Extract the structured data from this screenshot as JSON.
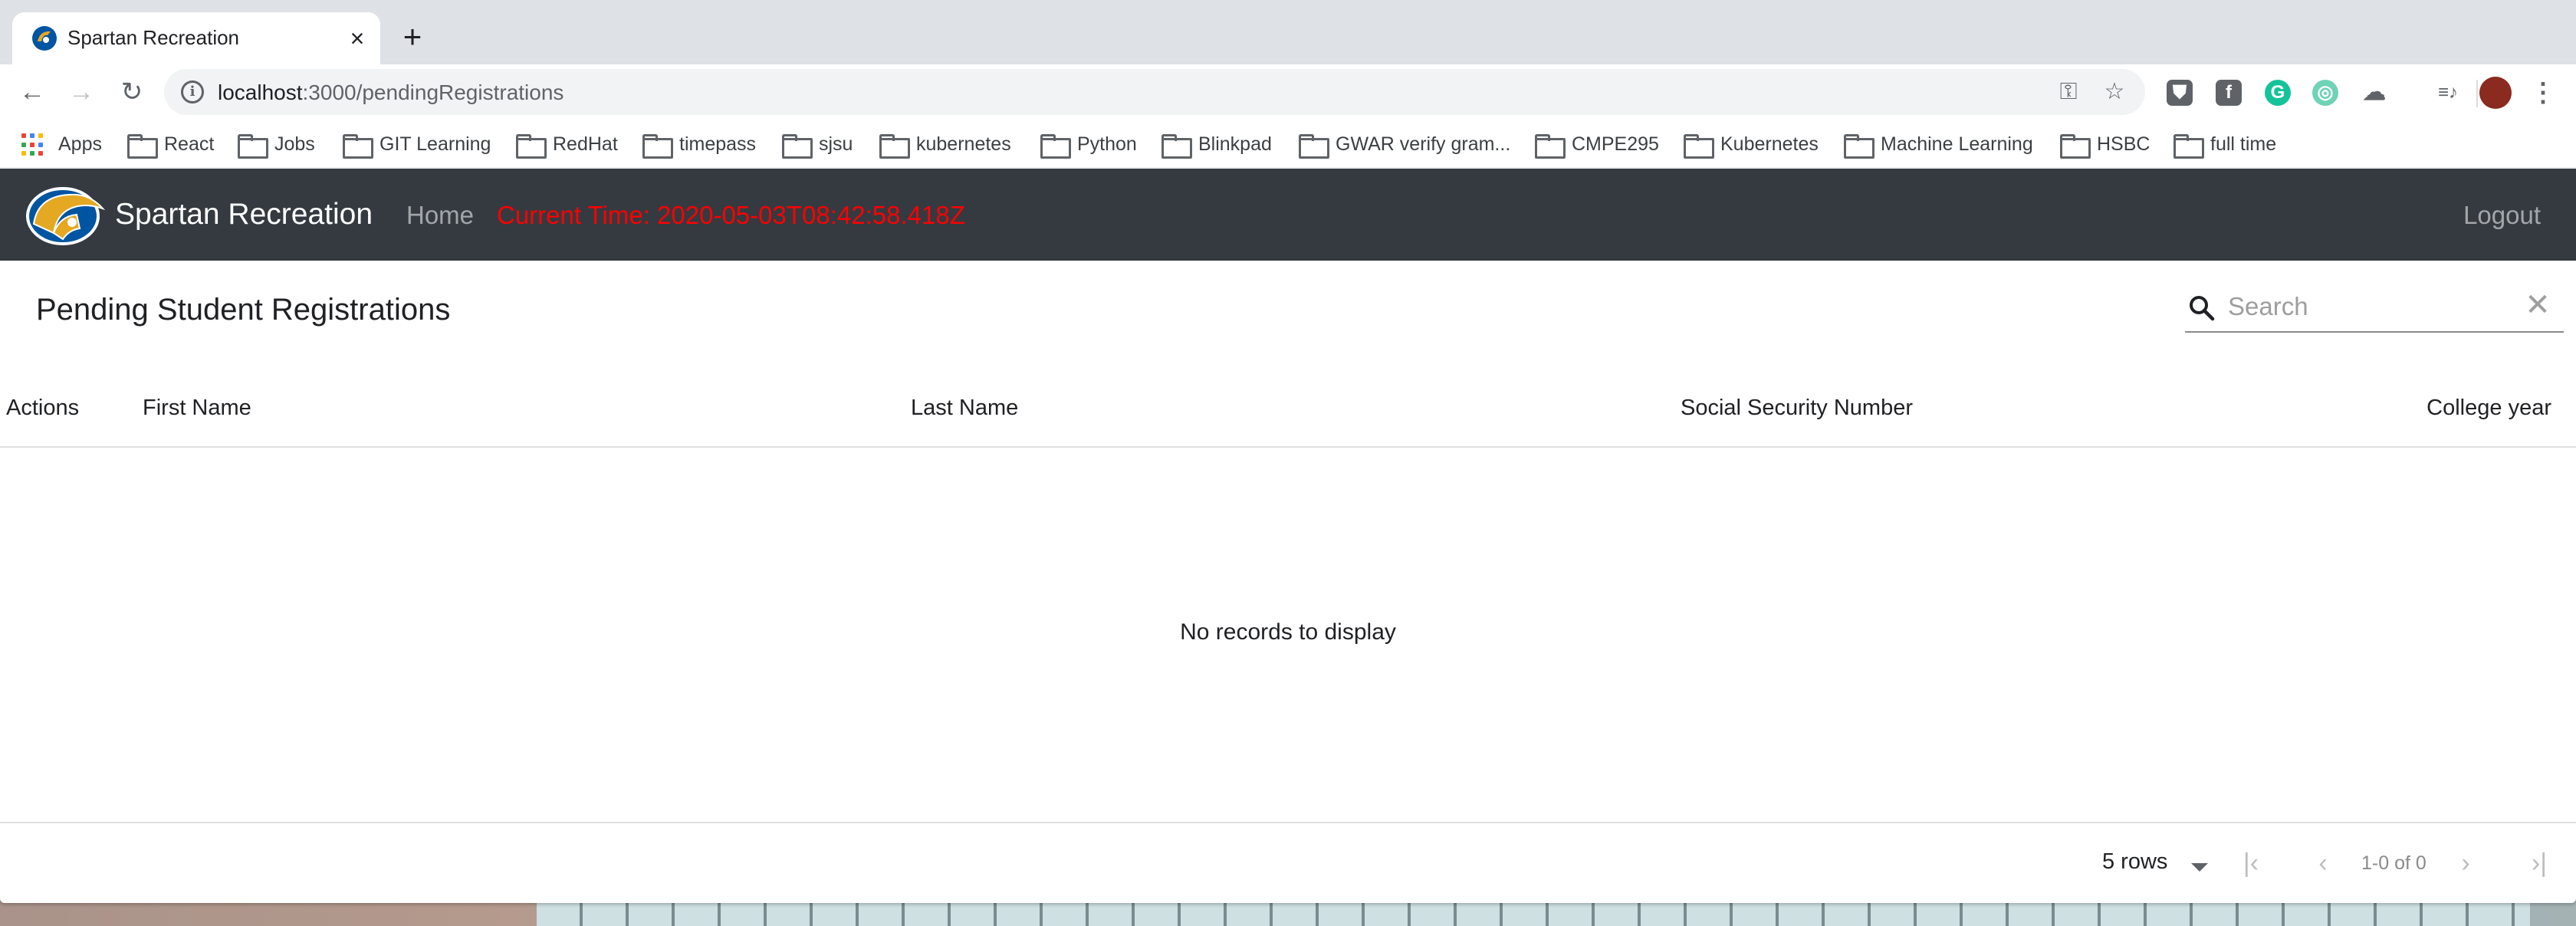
{
  "browser": {
    "tab": {
      "title": "Spartan Recreation",
      "close_glyph": "×"
    },
    "new_tab_glyph": "+",
    "address": {
      "host": "localhost",
      "path": ":3000/pendingRegistrations"
    },
    "nav": {
      "back": "←",
      "forward": "→",
      "reload": "↻"
    },
    "omnibox_icons": {
      "key": "⚿",
      "star": "☆"
    },
    "extensions": [
      {
        "name": "shield-extension-icon",
        "glyph": "⛊",
        "color": "#5f6368"
      },
      {
        "name": "facebook-extension-icon",
        "glyph": "f",
        "color": "#5f6368"
      },
      {
        "name": "grammarly-extension-icon",
        "glyph": "G",
        "color": "#15c39a"
      },
      {
        "name": "color-picker-extension-icon",
        "glyph": "◎",
        "color": "#6fd3b5"
      },
      {
        "name": "cloud-extension-icon",
        "glyph": "☁",
        "color": "#5f6368"
      }
    ],
    "menu_glyph": "⋮",
    "media_glyph": "≡♪"
  },
  "bookmarks": {
    "apps_label": "Apps",
    "items": [
      "React",
      "Jobs",
      "GIT Learning",
      "RedHat",
      "timepass",
      "sjsu",
      "kubernetes",
      "Python",
      "Blinkpad",
      "GWAR verify gram...",
      "CMPE295",
      "Kubernetes",
      "Machine Learning",
      "HSBC",
      "full time"
    ]
  },
  "app": {
    "brand": "Spartan Recreation",
    "nav_home": "Home",
    "current_time": "Current Time: 2020-05-03T08:42:58.418Z",
    "logout": "Logout"
  },
  "table": {
    "title": "Pending Student Registrations",
    "search_placeholder": "Search",
    "clear_glyph": "✕",
    "columns": [
      "Actions",
      "First Name",
      "Last Name",
      "Social Security Number",
      "College year"
    ],
    "empty_message": "No records to display",
    "rows_per_page": "5 rows",
    "page_info": "1-0 of 0",
    "pager": {
      "first": "|‹",
      "prev": "‹",
      "next": "›",
      "last": "›|"
    }
  },
  "colors": {
    "appbar": "#343a40",
    "time_text": "#ff0000",
    "tabstrip": "#dee1e6"
  }
}
